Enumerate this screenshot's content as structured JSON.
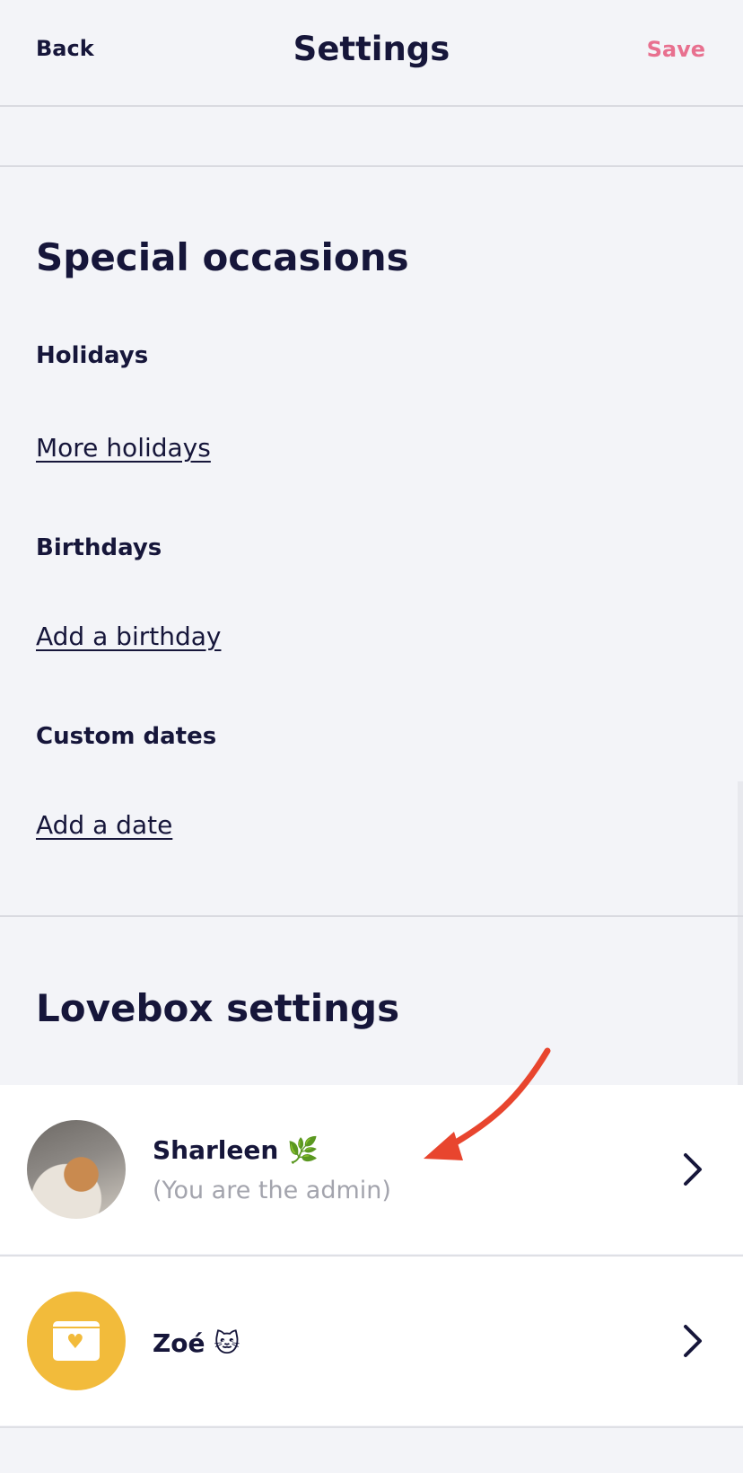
{
  "header": {
    "back_label": "Back",
    "title": "Settings",
    "save_label": "Save"
  },
  "colors": {
    "accent": "#e8708f",
    "text": "#16163a",
    "muted": "#a3a4ad",
    "avatar_yellow": "#f2bb3b",
    "annotation_arrow": "#e8452e"
  },
  "special_occasions": {
    "title": "Special occasions",
    "holidays_label": "Holidays",
    "holidays_link": "More holidays",
    "birthdays_label": "Birthdays",
    "birthdays_link": "Add a birthday",
    "custom_label": "Custom dates",
    "custom_link": "Add a date"
  },
  "lovebox_settings": {
    "title": "Lovebox settings",
    "members": [
      {
        "name": "Sharleen 🌿",
        "subtitle": "(You are the admin)",
        "avatar": "cat-photo"
      },
      {
        "name": "Zoé 🐱",
        "avatar": "lovebox-icon"
      }
    ]
  }
}
